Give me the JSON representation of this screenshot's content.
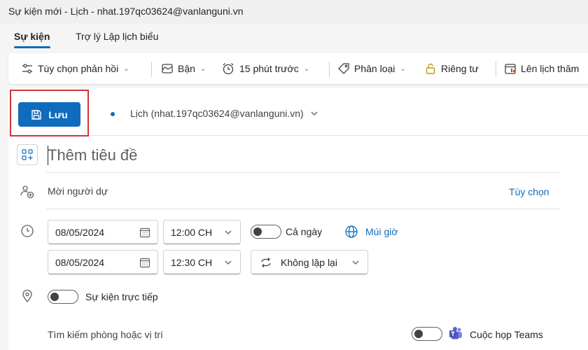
{
  "window": {
    "title": "Sự kiện mới - Lịch - nhat.197qc03624@vanlanguni.vn"
  },
  "tabs": [
    {
      "label": "Sự kiện",
      "active": true
    },
    {
      "label": "Trợ lý Lập lịch biểu",
      "active": false
    }
  ],
  "ribbon": {
    "response_options": "Tùy chọn phản hồi",
    "busy": "Bận",
    "reminder": "15 phút trước",
    "categorize": "Phân loại",
    "private": "Riêng tư",
    "schedule": "Lên lịch thăm"
  },
  "toolbar": {
    "save_label": "Lưu",
    "calendar": "Lịch (nhat.197qc03624@vanlanguni.vn)"
  },
  "form": {
    "title_placeholder": "Thêm tiêu đề",
    "attendees_placeholder": "Mời người dự",
    "options_link": "Tùy chọn",
    "start_date": "08/05/2024",
    "start_time": "12:00 CH",
    "all_day": "Cả ngày",
    "time_zone": "Múi giờ",
    "end_date": "08/05/2024",
    "end_time": "12:30 CH",
    "repeat": "Không lặp lại",
    "in_person": "Sự kiện trực tiếp",
    "location_placeholder": "Tìm kiếm phòng hoặc vị trí",
    "teams_meeting": "Cuộc họp Teams"
  },
  "colors": {
    "accent": "#0f6cbd",
    "highlight": "#d13438",
    "teams": "#5b5fc7"
  }
}
